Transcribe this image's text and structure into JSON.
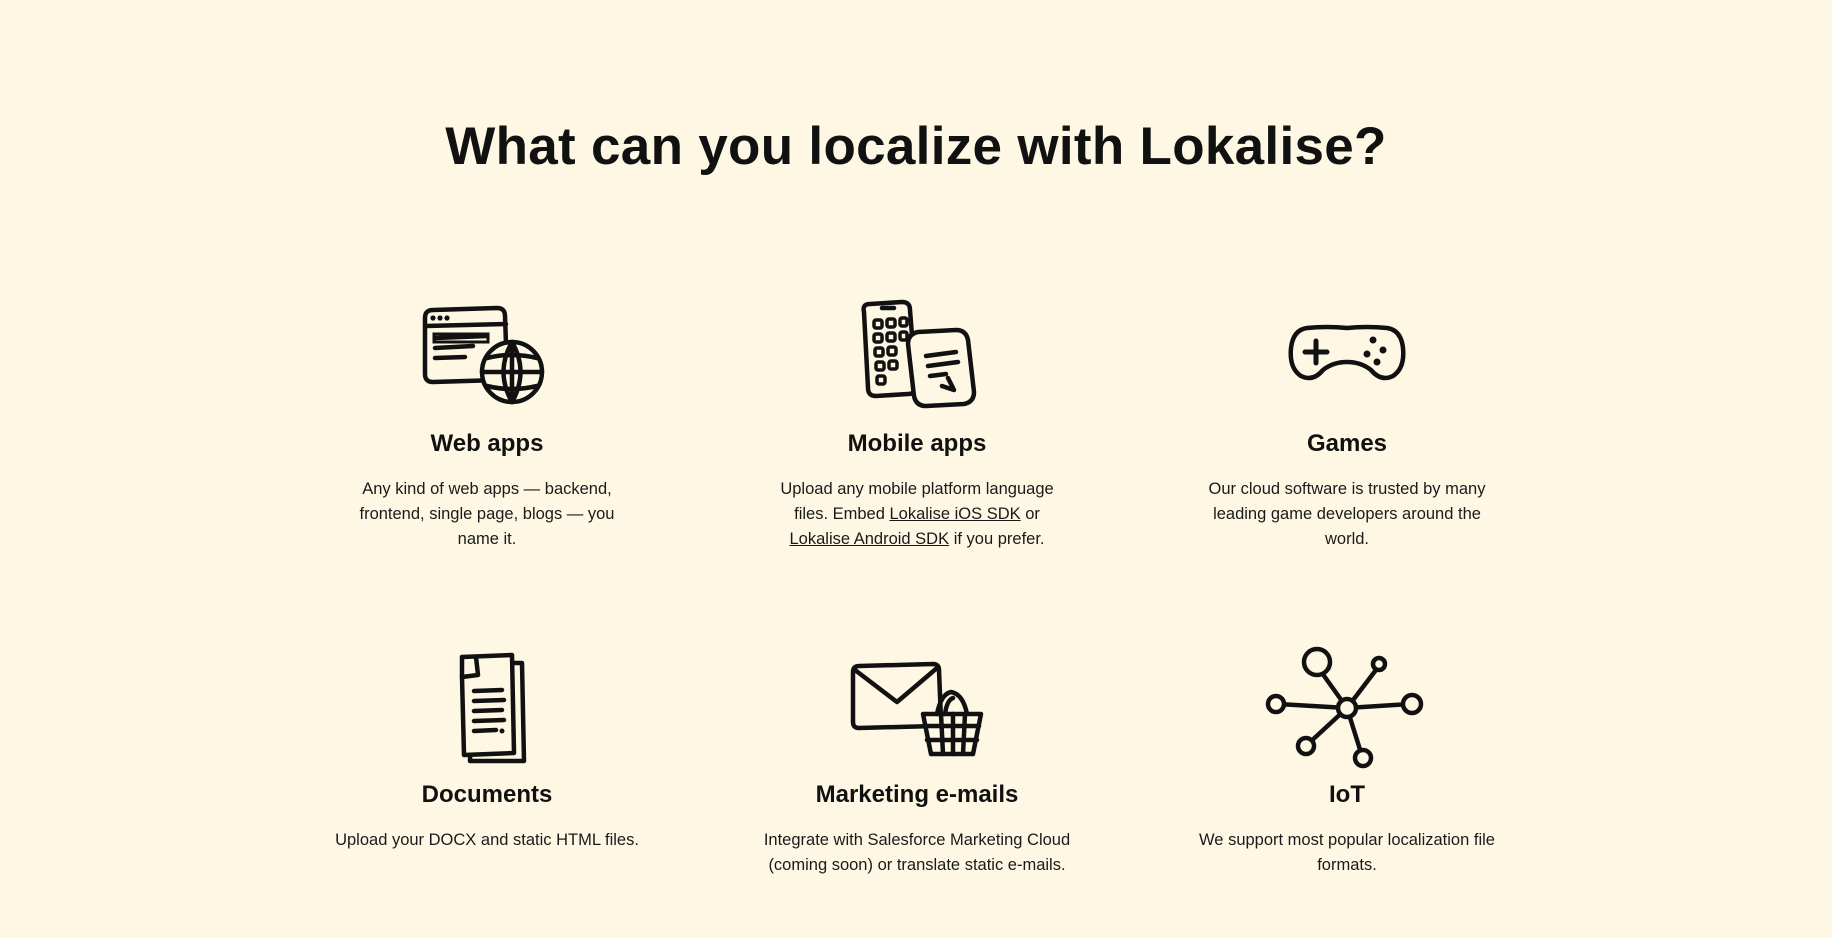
{
  "heading": "What can you localize with Lokalise?",
  "cards": [
    {
      "title": "Web apps",
      "icon": "browser-globe-icon",
      "desc": "Any kind of web apps — backend, frontend, single page, blogs — you name it."
    },
    {
      "title": "Mobile apps",
      "icon": "phone-chat-icon",
      "desc_pre": "Upload any mobile platform language files. Embed ",
      "link1": "Lokalise iOS SDK",
      "desc_mid": " or ",
      "link2": "Lokalise Android SDK",
      "desc_post": " if you prefer."
    },
    {
      "title": "Games",
      "icon": "gamepad-icon",
      "desc": "Our cloud software is trusted by many leading game developers around the world."
    },
    {
      "title": "Documents",
      "icon": "documents-icon",
      "desc": "Upload your DOCX and static HTML files."
    },
    {
      "title": "Marketing e-mails",
      "icon": "envelope-basket-icon",
      "desc": "Integrate with Salesforce Marketing Cloud (coming soon) or translate static e-mails."
    },
    {
      "title": "IoT",
      "icon": "network-nodes-icon",
      "desc": "We support most popular localization file formats."
    }
  ]
}
